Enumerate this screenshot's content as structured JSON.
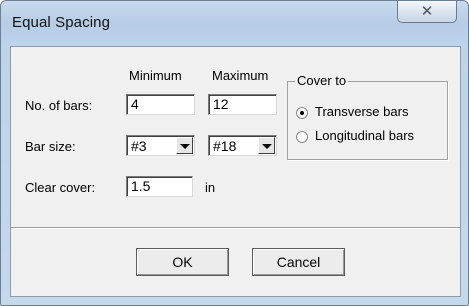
{
  "window": {
    "title": "Equal Spacing",
    "close_glyph": "✕"
  },
  "headers": {
    "minimum": "Minimum",
    "maximum": "Maximum"
  },
  "rows": {
    "num_bars": {
      "label": "No. of bars:",
      "min": "4",
      "max": "12"
    },
    "bar_size": {
      "label": "Bar size:",
      "min": "#3",
      "max": "#18"
    },
    "clear_cover": {
      "label": "Clear cover:",
      "value": "1.5",
      "unit": "in"
    }
  },
  "cover_to": {
    "legend": "Cover to",
    "options": [
      {
        "label": "Transverse bars",
        "selected": true
      },
      {
        "label": "Longitudinal bars",
        "selected": false
      }
    ]
  },
  "buttons": {
    "ok": "OK",
    "cancel": "Cancel"
  }
}
